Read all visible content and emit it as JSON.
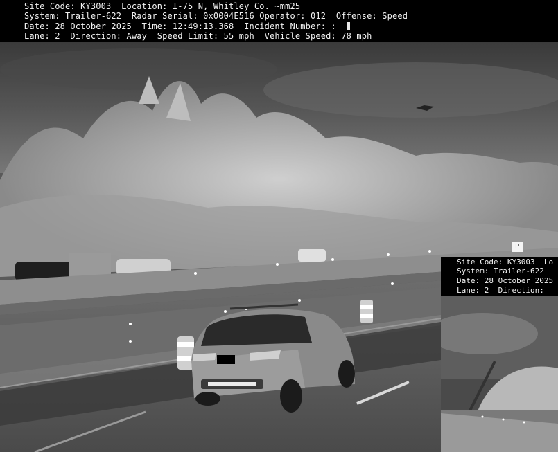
{
  "overlay": {
    "line1": "Site Code: KY3003  Location: I-75 N, Whitley Co. ~mm25",
    "line2": "System: Trailer-622  Radar Serial: 0x0004E516 Operator: 012  Offense: Speed",
    "line3": "Date: 28 October 2025  Time: 12:49:13.368  Incident Number: :",
    "line4": "Lane: 2  Direction: Away  Speed Limit: 55 mph  Vehicle Speed: 78 mph"
  },
  "inset": {
    "line1": "Site Code: KY3003  Lo",
    "line2": "System: Trailer-622",
    "line3": "Date: 28 October 2025",
    "line4": "Lane: 2  Direction: "
  },
  "sign": {
    "text": "P"
  },
  "colors": {
    "overlay_bg": "#000000",
    "overlay_text": "#f2f2f2"
  }
}
